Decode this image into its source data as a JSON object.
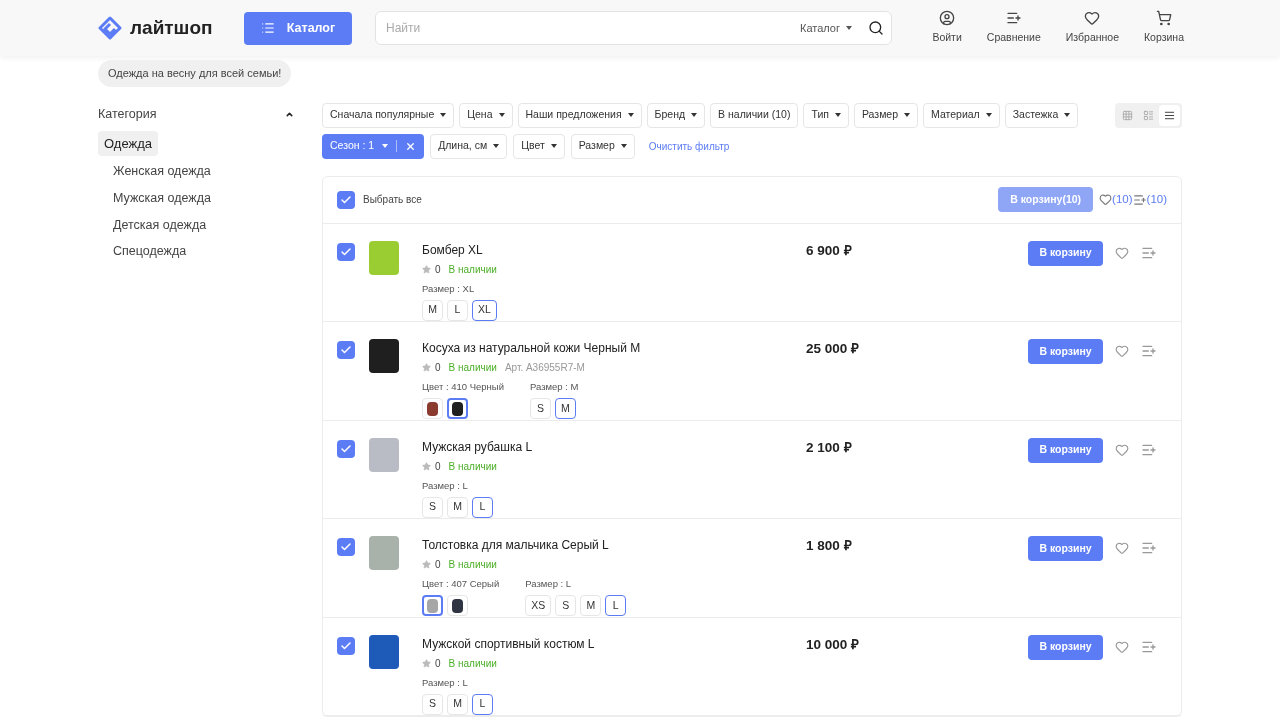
{
  "header": {
    "logo": "лайтшоп",
    "catalog_button": "Каталог",
    "search": {
      "placeholder": "Найти",
      "scope": "Каталог"
    },
    "actions": [
      {
        "kind": "user",
        "label": "Войти"
      },
      {
        "kind": "compare",
        "label": "Сравнение"
      },
      {
        "kind": "favorite",
        "label": "Избранное"
      },
      {
        "kind": "cart",
        "label": "Корзина"
      }
    ]
  },
  "promo_tag": "Одежда на весну для всей семьи!",
  "sidebar": {
    "title": "Категория",
    "expanded": true,
    "items": [
      {
        "label": "Одежда",
        "selected": true,
        "children": [
          {
            "label": "Женская одежда",
            "selected": false
          },
          {
            "label": "Мужская одежда",
            "selected": false
          },
          {
            "label": "Детская одежда",
            "selected": false
          },
          {
            "label": "Спецодежда",
            "selected": false
          }
        ]
      }
    ]
  },
  "filters": [
    {
      "label": "Сначала популярные",
      "active": false,
      "dropdown": true
    },
    {
      "label": "Цена",
      "active": false,
      "dropdown": true
    },
    {
      "label": "Наши предложения",
      "active": false,
      "dropdown": true
    },
    {
      "label": "Бренд",
      "active": false,
      "dropdown": true
    },
    {
      "label": "В наличии (10)",
      "active": false,
      "dropdown": false
    },
    {
      "label": "Тип",
      "active": false,
      "dropdown": true
    },
    {
      "label": "Размер",
      "active": false,
      "dropdown": true
    },
    {
      "label": "Материал",
      "active": false,
      "dropdown": true
    },
    {
      "label": "Застежка",
      "active": false,
      "dropdown": true
    }
  ],
  "view_modes": [
    {
      "kind": "grid",
      "selected": false
    },
    {
      "kind": "list",
      "selected": false
    },
    {
      "kind": "rows",
      "selected": true
    }
  ],
  "filters_row2": [
    {
      "label": "Сезон : 1",
      "active": true,
      "dropdown": true
    },
    {
      "label": "Длина, см",
      "active": false,
      "dropdown": true
    },
    {
      "label": "Цвет",
      "active": false,
      "dropdown": true
    },
    {
      "label": "Размер",
      "active": false,
      "dropdown": true
    }
  ],
  "clear_filter": "Очистить фильтр",
  "toolbar": {
    "select_all": {
      "label": "Выбрать все",
      "checked": true
    },
    "cart_button": "В корзину(10)",
    "favorites_count": "(10)",
    "compare_count": "(10)"
  },
  "products": [
    {
      "checked": true,
      "color": "#9acd32",
      "name": "Бомбер XL",
      "rating": "0",
      "stock": "В наличии",
      "price": "6 900 ₽",
      "cart": "В корзину",
      "options": [
        {
          "kind": "size",
          "label": "Размер : XL",
          "values": [
            {
              "label": "M",
              "selected": false
            },
            {
              "label": "L",
              "selected": false
            },
            {
              "label": "XL",
              "selected": true
            }
          ]
        }
      ]
    },
    {
      "checked": true,
      "color": "#1f1f1f",
      "name": "Косуха из натуральной кожи Черный M",
      "rating": "0",
      "stock": "В наличии",
      "article": "Арт. A36955R7-M",
      "price": "25 000 ₽",
      "cart": "В корзину",
      "options": [
        {
          "kind": "color",
          "label": "Цвет : 410 Черный",
          "values": [
            {
              "color": "#8b3a2e",
              "selected": false
            },
            {
              "color": "#1f1f1f",
              "selected": true
            }
          ]
        },
        {
          "kind": "size",
          "label": "Размер : M",
          "values": [
            {
              "label": "S",
              "selected": false
            },
            {
              "label": "M",
              "selected": true
            }
          ]
        }
      ]
    },
    {
      "checked": true,
      "color": "#b9bcc4",
      "name": "Мужская рубашка L",
      "rating": "0",
      "stock": "В наличии",
      "price": "2 100 ₽",
      "cart": "В корзину",
      "options": [
        {
          "kind": "size",
          "label": "Размер : L",
          "values": [
            {
              "label": "S",
              "selected": false
            },
            {
              "label": "M",
              "selected": false
            },
            {
              "label": "L",
              "selected": true
            }
          ]
        }
      ]
    },
    {
      "checked": true,
      "color": "#a9b2aa",
      "name": "Толстовка для мальчика Серый L",
      "rating": "0",
      "stock": "В наличии",
      "price": "1 800 ₽",
      "cart": "В корзину",
      "options": [
        {
          "kind": "color",
          "label": "Цвет : 407 Серый",
          "values": [
            {
              "color": "#a6a6a6",
              "selected": true
            },
            {
              "color": "#2e3442",
              "selected": false
            }
          ]
        },
        {
          "kind": "size",
          "label": "Размер : L",
          "values": [
            {
              "label": "XS",
              "selected": false
            },
            {
              "label": "S",
              "selected": false
            },
            {
              "label": "M",
              "selected": false
            },
            {
              "label": "L",
              "selected": true
            }
          ]
        }
      ]
    },
    {
      "checked": true,
      "color": "#1e5bb8",
      "name": "Мужской спортивный костюм L",
      "rating": "0",
      "stock": "В наличии",
      "price": "10 000 ₽",
      "cart": "В корзину",
      "options": [
        {
          "kind": "size",
          "label": "Размер : L",
          "values": [
            {
              "label": "S",
              "selected": false
            },
            {
              "label": "M",
              "selected": false
            },
            {
              "label": "L",
              "selected": true
            }
          ]
        }
      ]
    }
  ]
}
